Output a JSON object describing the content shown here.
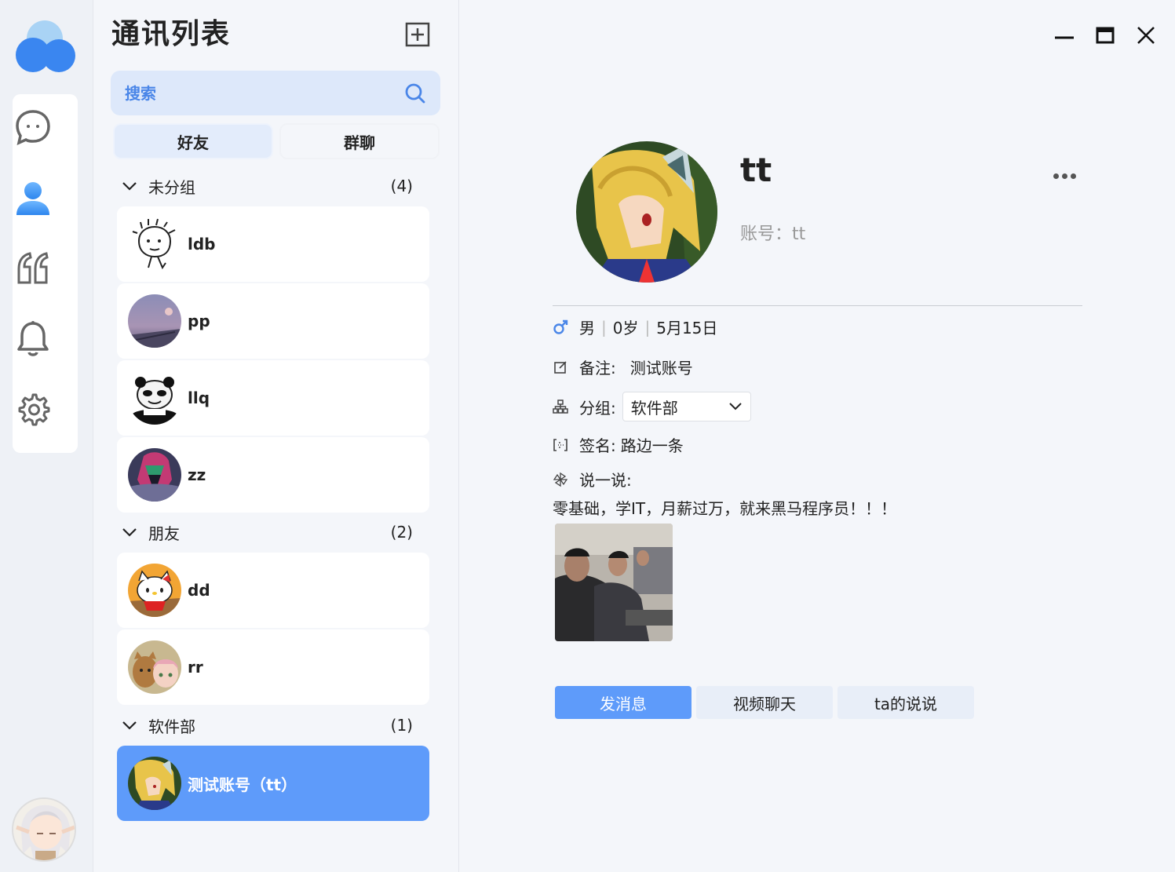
{
  "contacts_panel": {
    "title": "通讯列表",
    "search_placeholder": "搜索",
    "tabs": [
      {
        "label": "好友",
        "active": true
      },
      {
        "label": "群聊",
        "active": false
      }
    ],
    "groups": [
      {
        "name": "未分组",
        "count": "(4)",
        "members": [
          "ldb",
          "pp",
          "llq",
          "zz"
        ]
      },
      {
        "name": "朋友",
        "count": "(2)",
        "members": [
          "dd",
          "rr"
        ]
      },
      {
        "name": "软件部",
        "count": "(1)",
        "members": [
          "测试账号（tt）"
        ]
      }
    ]
  },
  "profile": {
    "name": "tt",
    "account": "账号：tt",
    "gender": "男",
    "age": "0岁",
    "birthday": "5月15日",
    "remark_label": "备注:",
    "remark_value": "测试账号",
    "group_label": "分组:",
    "group_value": "软件部",
    "signature_label": "签名:",
    "signature_value": "路边一条",
    "moment_label": "说一说:",
    "moment_text": "零基础，学IT，月薪过万，就来黑马程序员！！！"
  },
  "actions": {
    "send_message": "发消息",
    "video_chat": "视频聊天",
    "moments": "ta的说说"
  },
  "colors": {
    "accent": "#5e9bfa",
    "search_bg": "#dde8fa",
    "search_text": "#4a86e8"
  }
}
